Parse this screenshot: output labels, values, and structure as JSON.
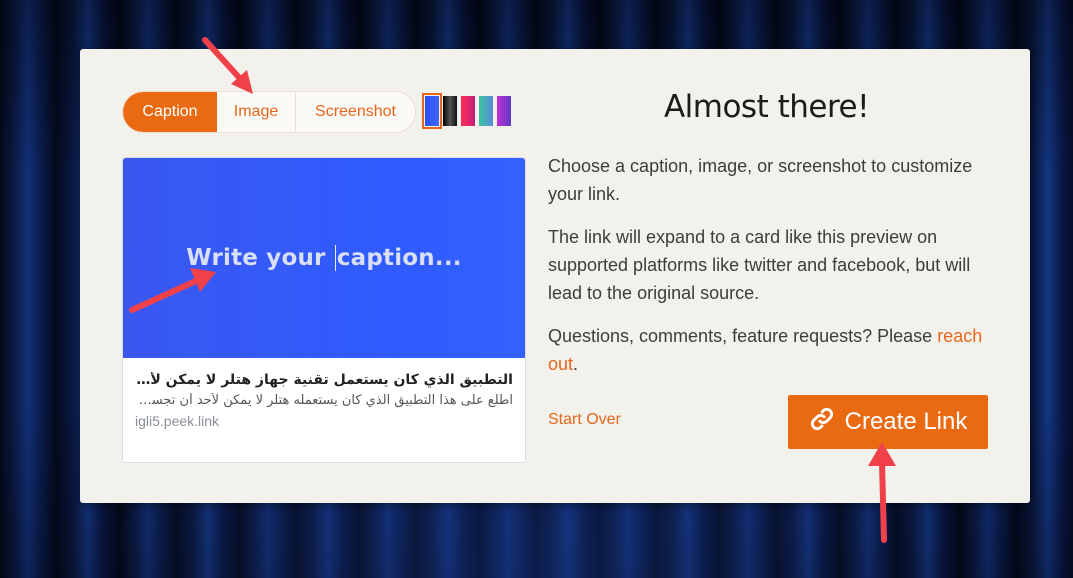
{
  "tabs": [
    {
      "label": "Caption"
    },
    {
      "label": "Image"
    },
    {
      "label": "Screenshot"
    }
  ],
  "swatch_colors": [
    "#2f5bff",
    "#111111",
    "#e0215a",
    "#4fb0a2",
    "#8e3bc9"
  ],
  "preview": {
    "caption_placeholder_before": "Write your",
    "caption_placeholder_after": "caption...",
    "title": "التطبيق الذي كان يستعمل تقنية جهاز هتلر لا يمكن لأحد أن يتجسس عليك أبدا",
    "description": "اطلع على هذا التطبيق الذي كان يستعمله هتلر لا يمكن لأحد أن تجسس عليك أبدا",
    "domain": "igli5.peek.link"
  },
  "heading": "Almost there!",
  "paragraphs": {
    "p1": "Choose a caption, image, or screenshot to customize your link.",
    "p2": "The link will expand to a card like this preview on supported platforms like twitter and facebook, but will lead to the original source.",
    "p3_prefix": "Questions, comments, feature requests? Please ",
    "p3_link": "reach out",
    "p3_suffix": "."
  },
  "actions": {
    "start_over": "Start Over",
    "create_link": "Create Link"
  },
  "colors": {
    "accent": "#ea6a11",
    "annotation_arrow": "#f0404a"
  },
  "icons": {
    "create_link": "link-chain-icon"
  }
}
